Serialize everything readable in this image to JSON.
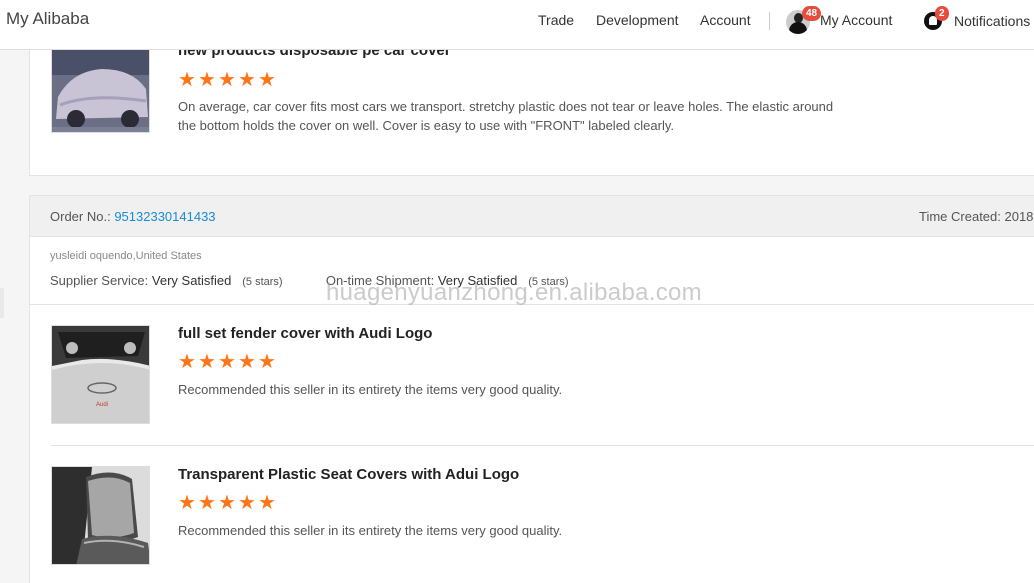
{
  "header": {
    "brand": "My Alibaba",
    "nav": {
      "trade": "Trade",
      "development": "Development",
      "account": "Account"
    },
    "my_account": {
      "label": "My Account",
      "badge": "48"
    },
    "notifications": {
      "label": "Notifications",
      "badge": "2"
    }
  },
  "review1": {
    "product_title": "new products disposable pe car cover",
    "rating_stars": 5,
    "comment": "On average, car cover fits most cars we transport.  stretchy plastic does not tear or leave holes.  The elastic around the bottom holds the cover on well.  Cover is easy to use with \"FRONT\" labeled clearly."
  },
  "order": {
    "order_label": "Order No.:",
    "order_number": "95132330141433",
    "time_label": "Time Created: 2018",
    "buyer": "yusleidi oquendo,United States",
    "supplier_service_label": "Supplier Service:",
    "supplier_service_value": "Very Satisfied",
    "supplier_service_stars": "(5 stars)",
    "shipment_label": "On-time Shipment:",
    "shipment_value": "Very Satisfied",
    "shipment_stars": "(5 stars)"
  },
  "items": [
    {
      "product_title": "full set fender cover with Audi Logo",
      "rating_stars": 5,
      "comment": "Recommended this seller in its entirety the items very good quality."
    },
    {
      "product_title": "Transparent Plastic Seat Covers with Adui Logo",
      "rating_stars": 5,
      "comment": "Recommended this seller in its entirety the items very good quality."
    }
  ],
  "watermark": "huagenyuanzhong.en.alibaba.com",
  "colors": {
    "star": "#ff7519",
    "link": "#1a8bd4",
    "badge": "#e74c3c"
  }
}
